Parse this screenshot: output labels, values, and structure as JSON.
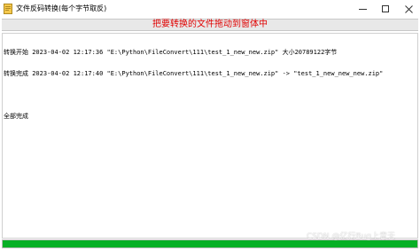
{
  "window": {
    "title": "文件反码转换(每个字节取反)",
    "controls": {
      "minimize": "—",
      "maximize": "☐",
      "close": "✕"
    }
  },
  "banner": {
    "text": "把要转换的文件拖动到窗体中",
    "color": "#e00000"
  },
  "log": {
    "lines": [
      "转换开始 2023-04-02 12:17:36 \"E:\\Python\\FileConvert\\111\\test_1_new_new.zip\" 大小20789122字节",
      "转换完成 2023-04-02 12:17:40 \"E:\\Python\\FileConvert\\111\\test_1_new_new.zip\" -> \"test_1_new_new_new.zip\"",
      "",
      "全部完成"
    ]
  },
  "progress": {
    "value_percent": 100,
    "color": "#06b025"
  },
  "watermark": {
    "text": "CSDN @亿行Bug上青天"
  }
}
